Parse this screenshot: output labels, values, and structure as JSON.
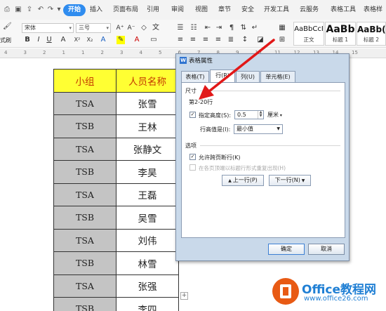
{
  "menubar": {
    "start_label": "开始",
    "tabs": [
      "插入",
      "页面布局",
      "引用",
      "审阅",
      "视图",
      "章节",
      "安全",
      "开发工具",
      "云服务",
      "表格工具",
      "表格样"
    ]
  },
  "ribbon": {
    "format_painter_label": "式刷",
    "font_name": "宋体",
    "font_size": "三号",
    "style_cards": [
      {
        "sample": "AaBbCcI",
        "name": "正文"
      },
      {
        "sample": "AaBb",
        "name": "标题 1"
      },
      {
        "sample": "AaBb(",
        "name": "标题 2"
      }
    ]
  },
  "ruler": {
    "numbers": [
      "4",
      "3",
      "2",
      "1",
      "1",
      "2",
      "3",
      "4",
      "5",
      "6",
      "7",
      "8",
      "9",
      "10",
      "11",
      "12",
      "13",
      "14",
      "15"
    ]
  },
  "table": {
    "headers": [
      "小组",
      "人员名称"
    ],
    "rows": [
      [
        "TSA",
        "张雪"
      ],
      [
        "TSB",
        "王林"
      ],
      [
        "TSA",
        "张静文"
      ],
      [
        "TSB",
        "李昊"
      ],
      [
        "TSA",
        "王磊"
      ],
      [
        "TSB",
        "吴雪"
      ],
      [
        "TSA",
        "刘伟"
      ],
      [
        "TSB",
        "林雪"
      ],
      [
        "TSA",
        "张强"
      ],
      [
        "TSB",
        "李四"
      ]
    ],
    "add_symbol": "+"
  },
  "dialog": {
    "title": "表格属性",
    "tabs": [
      "表格(T)",
      "行(R)",
      "列(U)",
      "单元格(E)"
    ],
    "size_section": "尺寸",
    "rows_label": "第2-20行",
    "specify_height_label": "指定高度(S):",
    "height_value": "0.5",
    "unit": "厘米",
    "row_height_mode_label": "行高值是(I):",
    "row_height_mode": "最小值",
    "options_section": "选项",
    "allow_break_label": "允许跨页断行(K)",
    "repeat_header_label": "在各页顶端以标题行形式重复出现(H)",
    "prev_row_label": "上一行(P)",
    "next_row_label": "下一行(N)",
    "ok_label": "确定",
    "cancel_label": "取消"
  },
  "watermark": {
    "brand": "Office教程网",
    "url": "www.office26.com"
  },
  "colors": {
    "start_blue": "#2f8cef",
    "header_yellow": "#ffff33",
    "header_text": "#c43a00",
    "group_gray": "#c4c4c4",
    "annotation_red": "#e11818",
    "brand_orange": "#e85a14",
    "brand_blue": "#1f7fd4"
  }
}
